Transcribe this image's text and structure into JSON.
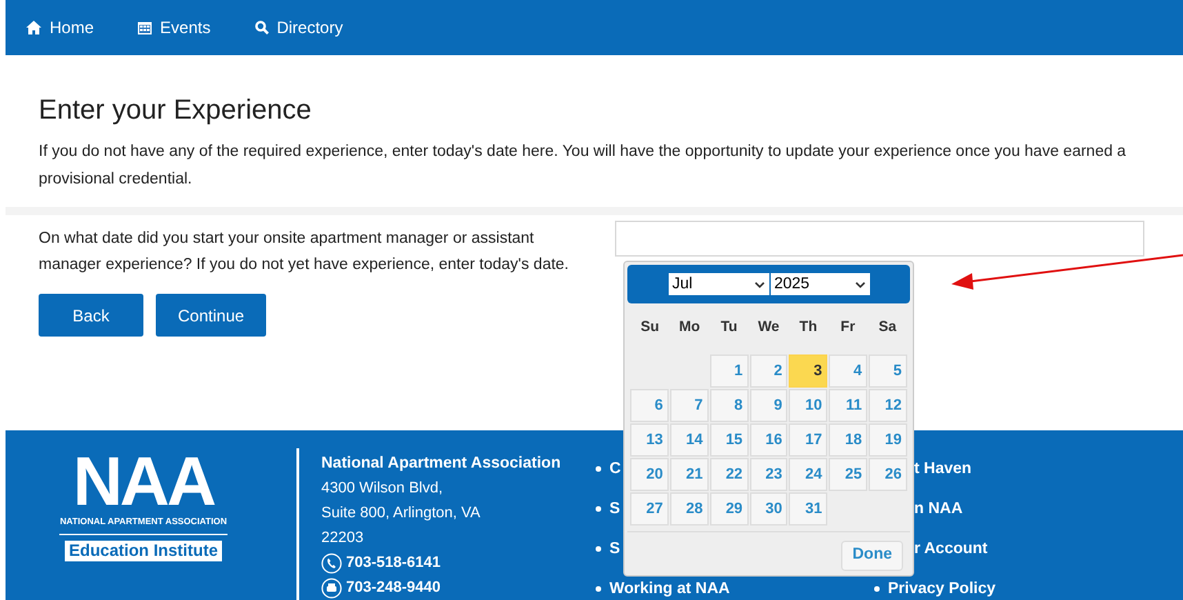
{
  "nav": {
    "items": [
      {
        "label": "Home",
        "kind": "home"
      },
      {
        "label": "Events",
        "kind": "calendar"
      },
      {
        "label": "Directory",
        "kind": "search"
      }
    ]
  },
  "page": {
    "title": "Enter your Experience",
    "intro": "If you do not have any of the required experience, enter today's date here.  You will have the opportunity to update your experience once you have earned a provisional credential.",
    "question": "On what date did you start your onsite apartment manager or assistant manager experience? If you do not yet have experience, enter today's date.",
    "buttons": [
      "Back",
      "Continue"
    ]
  },
  "datepicker": {
    "month": "Jul",
    "year": "2025",
    "weekdays": [
      "Su",
      "Mo",
      "Tu",
      "We",
      "Th",
      "Fr",
      "Sa"
    ],
    "days": [
      {
        "kind": "blank"
      },
      {
        "kind": "blank"
      },
      {
        "kind": "day",
        "label": "1",
        "selected": false
      },
      {
        "kind": "day",
        "label": "2",
        "selected": false
      },
      {
        "kind": "day",
        "label": "3",
        "selected": true
      },
      {
        "kind": "day",
        "label": "4",
        "selected": false
      },
      {
        "kind": "day",
        "label": "5",
        "selected": false
      },
      {
        "kind": "day",
        "label": "6",
        "selected": false
      },
      {
        "kind": "day",
        "label": "7",
        "selected": false
      },
      {
        "kind": "day",
        "label": "8",
        "selected": false
      },
      {
        "kind": "day",
        "label": "9",
        "selected": false
      },
      {
        "kind": "day",
        "label": "10",
        "selected": false
      },
      {
        "kind": "day",
        "label": "11",
        "selected": false
      },
      {
        "kind": "day",
        "label": "12",
        "selected": false
      },
      {
        "kind": "day",
        "label": "13",
        "selected": false
      },
      {
        "kind": "day",
        "label": "14",
        "selected": false
      },
      {
        "kind": "day",
        "label": "15",
        "selected": false
      },
      {
        "kind": "day",
        "label": "16",
        "selected": false
      },
      {
        "kind": "day",
        "label": "17",
        "selected": false
      },
      {
        "kind": "day",
        "label": "18",
        "selected": false
      },
      {
        "kind": "day",
        "label": "19",
        "selected": false
      },
      {
        "kind": "day",
        "label": "20",
        "selected": false
      },
      {
        "kind": "day",
        "label": "21",
        "selected": false
      },
      {
        "kind": "day",
        "label": "22",
        "selected": false
      },
      {
        "kind": "day",
        "label": "23",
        "selected": false
      },
      {
        "kind": "day",
        "label": "24",
        "selected": false
      },
      {
        "kind": "day",
        "label": "25",
        "selected": false
      },
      {
        "kind": "day",
        "label": "26",
        "selected": false
      },
      {
        "kind": "day",
        "label": "27",
        "selected": false
      },
      {
        "kind": "day",
        "label": "28",
        "selected": false
      },
      {
        "kind": "day",
        "label": "29",
        "selected": false
      },
      {
        "kind": "day",
        "label": "30",
        "selected": false
      },
      {
        "kind": "day",
        "label": "31",
        "selected": false
      }
    ],
    "done": "Done"
  },
  "footer": {
    "logo": {
      "mark": "NAA",
      "tagline": "NATIONAL APARTMENT ASSOCIATION",
      "subtitle": "Education Institute"
    },
    "address": {
      "heading": "National Apartment Association",
      "lines": [
        "4300 Wilson Blvd,",
        "Suite 800, Arlington, VA",
        "22203"
      ],
      "phones": [
        {
          "kind": "phone",
          "number": "703-518-6141"
        },
        {
          "kind": "fax",
          "number": "703-248-9440"
        }
      ]
    },
    "links_1": [
      {
        "label": "C"
      },
      {
        "label": "S"
      },
      {
        "label": "S"
      },
      {
        "label": "Working at NAA"
      }
    ],
    "links_2": [
      {
        "label": "t Haven",
        "kind": "partial"
      },
      {
        "label": "n NAA",
        "kind": "partial"
      },
      {
        "label": "r Account",
        "kind": "partial"
      },
      {
        "label": "Privacy Policy",
        "kind": "full"
      }
    ]
  }
}
